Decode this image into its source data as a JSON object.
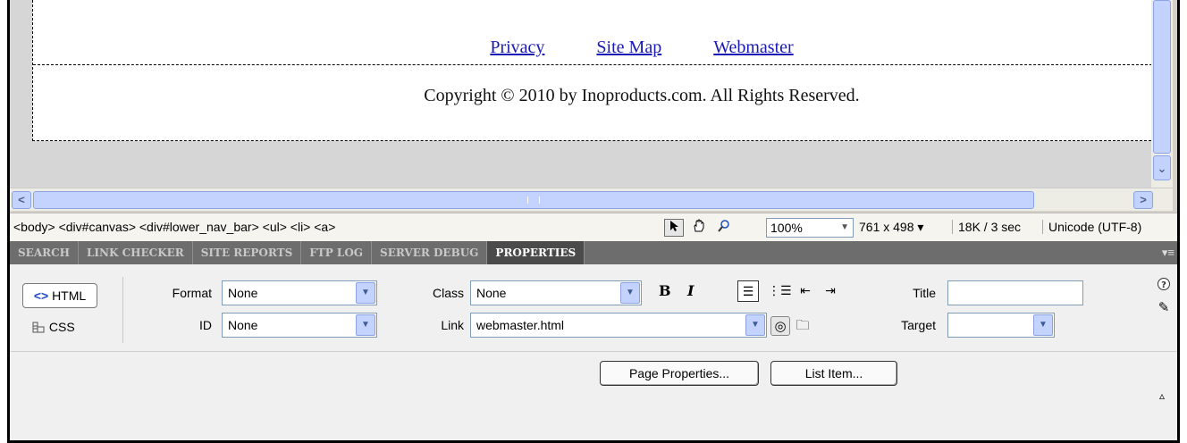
{
  "canvas": {
    "links": [
      "Privacy",
      "Site Map",
      "Webmaster"
    ],
    "copyright": "Copyright © 2010 by Inoproducts.com. All Rights Reserved."
  },
  "scrollbars": {
    "left_arrow": "<",
    "right_arrow": ">",
    "down_arrow": "⌄"
  },
  "status_bar": {
    "tag_selector": "<body> <div#canvas> <div#lower_nav_bar> <ul> <li> <a>",
    "zoom": "100%",
    "window_size": "761 x 498 ▾",
    "download": "18K / 3 sec",
    "encoding": "Unicode (UTF-8)"
  },
  "tabs": [
    {
      "label": "SEARCH",
      "active": false
    },
    {
      "label": "LINK CHECKER",
      "active": false
    },
    {
      "label": "SITE REPORTS",
      "active": false
    },
    {
      "label": "FTP LOG",
      "active": false
    },
    {
      "label": "SERVER DEBUG",
      "active": false
    },
    {
      "label": "PROPERTIES",
      "active": true
    }
  ],
  "properties": {
    "html_button": "HTML",
    "css_button": "CSS",
    "format_label": "Format",
    "format_value": "None",
    "id_label": "ID",
    "id_value": "None",
    "class_label": "Class",
    "class_value": "None",
    "link_label": "Link",
    "link_value": "webmaster.html",
    "bold": "B",
    "italic": "I",
    "title_label": "Title",
    "title_value": "",
    "target_label": "Target",
    "target_value": "",
    "page_properties_button": "Page Properties...",
    "list_item_button": "List Item..."
  },
  "icons": [
    "pointer-icon",
    "hand-icon",
    "zoom-icon",
    "help-icon",
    "edit-icon",
    "point-to-file-icon",
    "browse-folder-icon",
    "unordered-list-icon",
    "ordered-list-icon",
    "outdent-icon",
    "indent-icon",
    "expand-icon"
  ]
}
